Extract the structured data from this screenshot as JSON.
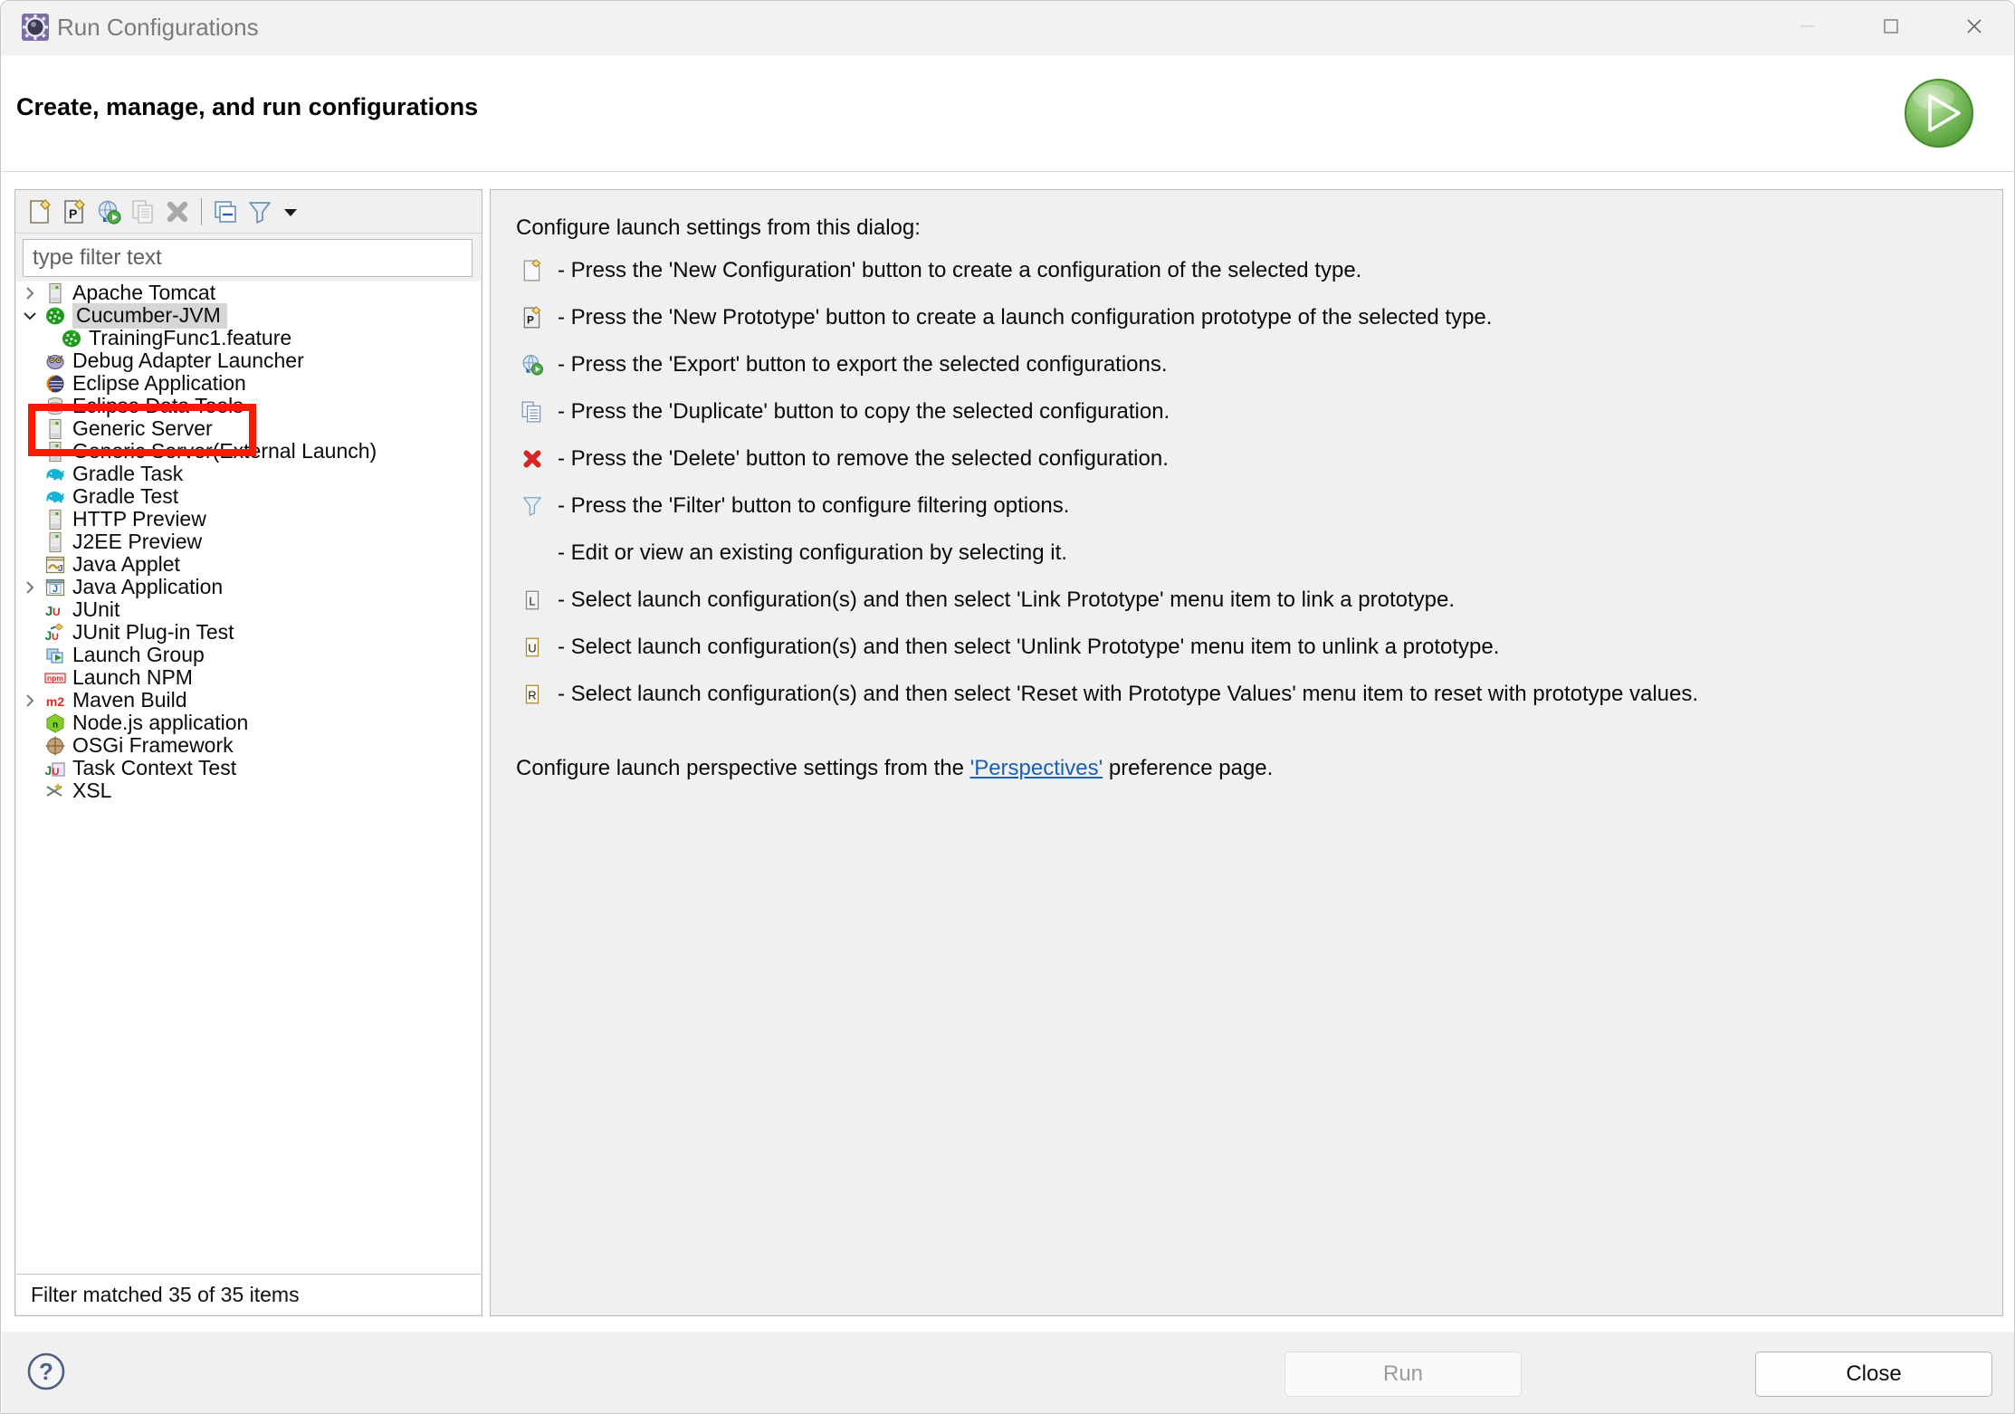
{
  "window": {
    "title": "Run Configurations",
    "icon": "run-configurations-icon",
    "minimize_label": "Minimize",
    "maximize_label": "Maximize",
    "close_label": "Close"
  },
  "header": {
    "title": "Create, manage, and run configurations",
    "run_icon": "green-run-play-icon",
    "accent_green": "#5aab3d"
  },
  "toolbar": {
    "buttons": [
      {
        "name": "new-configuration-button",
        "label": "New Configuration",
        "enabled": true
      },
      {
        "name": "new-prototype-button",
        "label": "New Prototype",
        "enabled": true
      },
      {
        "name": "export-button",
        "label": "Export",
        "enabled": true
      },
      {
        "name": "duplicate-button",
        "label": "Duplicate",
        "enabled": false
      },
      {
        "name": "delete-button",
        "label": "Delete",
        "enabled": false
      },
      {
        "name": "collapse-all-button",
        "label": "Collapse All",
        "enabled": true
      },
      {
        "name": "filter-button",
        "label": "Filter",
        "enabled": true
      }
    ],
    "menu_arrow_label": "View Menu"
  },
  "filter": {
    "value": "",
    "placeholder": "type filter text"
  },
  "tree": {
    "items": [
      {
        "label": "Apache Tomcat",
        "icon": "server-icon",
        "indent": 0,
        "expander": "collapsed",
        "selected": false
      },
      {
        "label": "Cucumber-JVM",
        "icon": "cucumber-icon",
        "indent": 0,
        "expander": "expanded",
        "selected": true
      },
      {
        "label": "TrainingFunc1.feature",
        "icon": "cucumber-icon",
        "indent": 1,
        "expander": "none",
        "selected": false
      },
      {
        "label": "Debug Adapter Launcher",
        "icon": "debug-adapter-icon",
        "indent": 0,
        "expander": "none",
        "selected": false
      },
      {
        "label": "Eclipse Application",
        "icon": "eclipse-icon",
        "indent": 0,
        "expander": "none",
        "selected": false
      },
      {
        "label": "Eclipse Data Tools",
        "icon": "database-icon",
        "indent": 0,
        "expander": "none",
        "selected": false
      },
      {
        "label": "Generic Server",
        "icon": "server-icon",
        "indent": 0,
        "expander": "none",
        "selected": false
      },
      {
        "label": "Generic Server(External Launch)",
        "icon": "server-icon",
        "indent": 0,
        "expander": "none",
        "selected": false
      },
      {
        "label": "Gradle Task",
        "icon": "gradle-elephant-icon",
        "indent": 0,
        "expander": "none",
        "selected": false
      },
      {
        "label": "Gradle Test",
        "icon": "gradle-elephant-icon",
        "indent": 0,
        "expander": "none",
        "selected": false
      },
      {
        "label": "HTTP Preview",
        "icon": "server-icon",
        "indent": 0,
        "expander": "none",
        "selected": false
      },
      {
        "label": "J2EE Preview",
        "icon": "server-icon",
        "indent": 0,
        "expander": "none",
        "selected": false
      },
      {
        "label": "Java Applet",
        "icon": "java-applet-icon",
        "indent": 0,
        "expander": "none",
        "selected": false
      },
      {
        "label": "Java Application",
        "icon": "java-application-icon",
        "indent": 0,
        "expander": "collapsed",
        "selected": false
      },
      {
        "label": "JUnit",
        "icon": "junit-icon",
        "indent": 0,
        "expander": "none",
        "selected": false
      },
      {
        "label": "JUnit Plug-in Test",
        "icon": "junit-plugin-icon",
        "indent": 0,
        "expander": "none",
        "selected": false
      },
      {
        "label": "Launch Group",
        "icon": "launch-group-icon",
        "indent": 0,
        "expander": "none",
        "selected": false
      },
      {
        "label": "Launch NPM",
        "icon": "npm-icon",
        "indent": 0,
        "expander": "none",
        "selected": false
      },
      {
        "label": "Maven Build",
        "icon": "maven-icon",
        "indent": 0,
        "expander": "collapsed",
        "selected": false
      },
      {
        "label": "Node.js application",
        "icon": "nodejs-icon",
        "indent": 0,
        "expander": "none",
        "selected": false
      },
      {
        "label": "OSGi Framework",
        "icon": "osgi-icon",
        "indent": 0,
        "expander": "none",
        "selected": false
      },
      {
        "label": "Task Context Test",
        "icon": "task-context-test-icon",
        "indent": 0,
        "expander": "none",
        "selected": false
      },
      {
        "label": "XSL",
        "icon": "xsl-icon",
        "indent": 0,
        "expander": "none",
        "selected": false
      }
    ],
    "status": "Filter matched 35 of 35 items"
  },
  "annotation": {
    "highlight_color": "#f91b00",
    "target": "Cucumber-JVM"
  },
  "details": {
    "intro": "Configure launch settings from this dialog:",
    "hints": [
      {
        "icon": "new-configuration-icon",
        "text": "- Press the 'New Configuration' button to create a configuration of the selected type."
      },
      {
        "icon": "new-prototype-icon",
        "text": "- Press the 'New Prototype' button to create a launch configuration prototype of the selected type."
      },
      {
        "icon": "export-icon",
        "text": "- Press the 'Export' button to export the selected configurations."
      },
      {
        "icon": "duplicate-icon",
        "text": "- Press the 'Duplicate' button to copy the selected configuration."
      },
      {
        "icon": "delete-icon",
        "text": "- Press the 'Delete' button to remove the selected configuration."
      },
      {
        "icon": "filter-icon",
        "text": "- Press the 'Filter' button to configure filtering options."
      },
      {
        "icon": "none",
        "text": "- Edit or view an existing configuration by selecting it."
      },
      {
        "icon": "link-prototype-icon",
        "text": "- Select launch configuration(s) and then select 'Link Prototype' menu item to link a prototype."
      },
      {
        "icon": "unlink-prototype-icon",
        "text": "- Select launch configuration(s) and then select 'Unlink Prototype' menu item to unlink a prototype."
      },
      {
        "icon": "reset-prototype-icon",
        "text": "- Select launch configuration(s) and then select 'Reset with Prototype Values' menu item to reset with prototype values."
      }
    ],
    "perspective_prefix": "Configure launch perspective settings from the ",
    "perspective_link": "'Perspectives'",
    "perspective_suffix": " preference page."
  },
  "footer": {
    "help_label": "Help",
    "run_label": "Run",
    "run_enabled": false,
    "close_label": "Close",
    "close_enabled": true
  }
}
